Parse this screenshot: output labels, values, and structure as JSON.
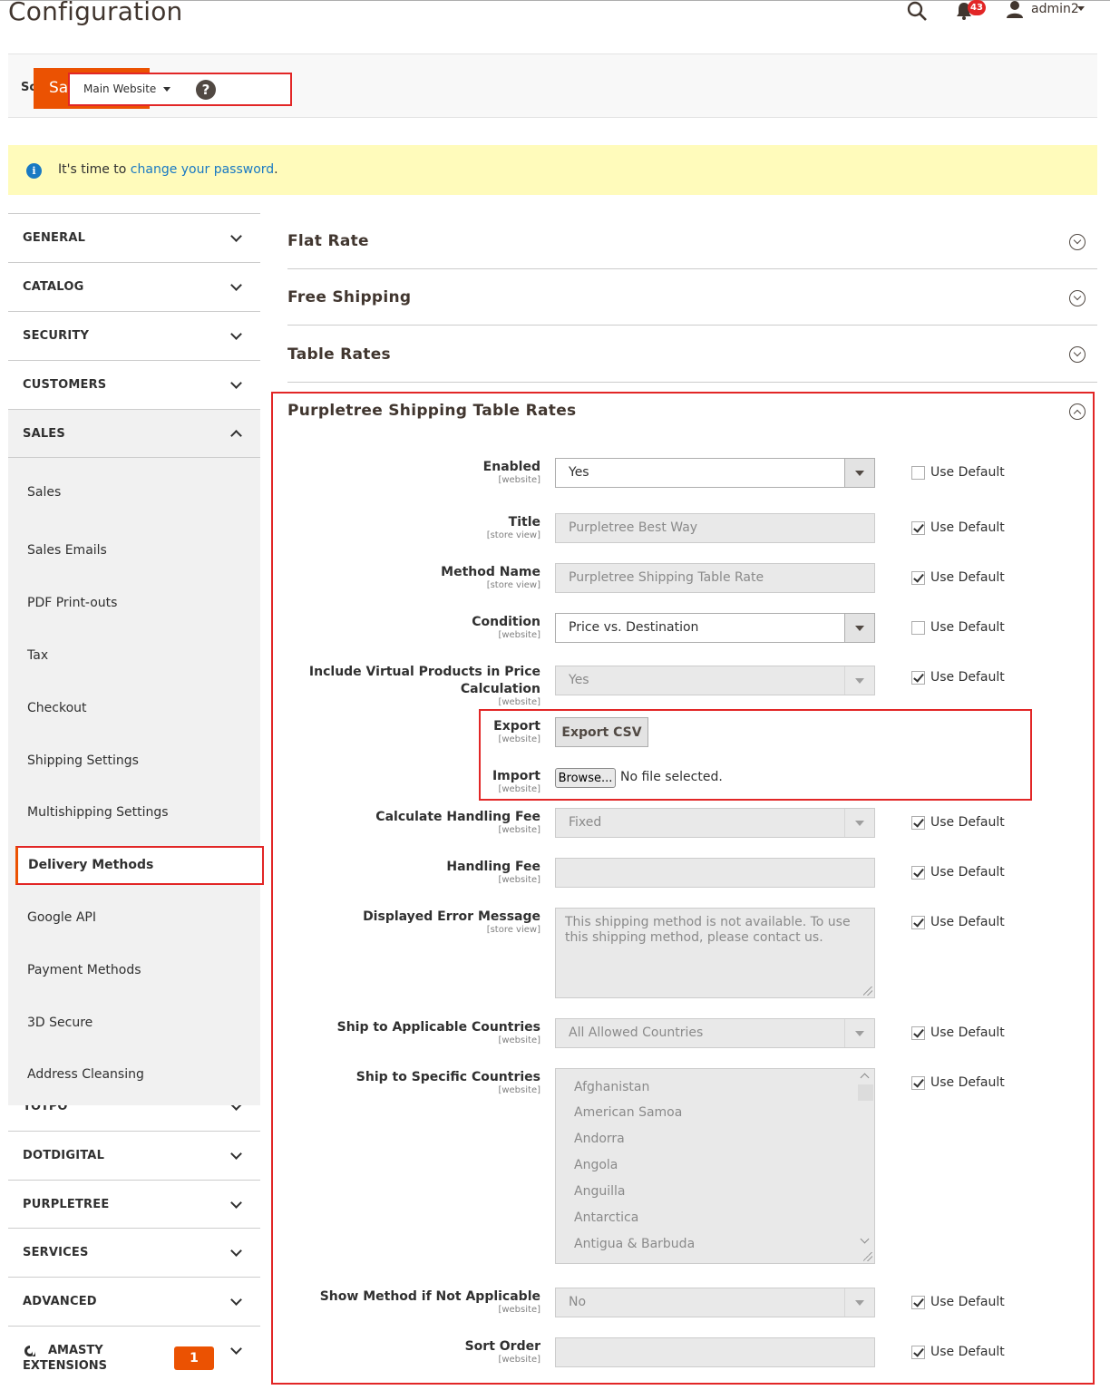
{
  "header": {
    "page_title": "Configuration",
    "notification_count": "43",
    "user_name": "admin2"
  },
  "pagebar": {
    "scope_label": "Sc",
    "save_label": "Save Config",
    "scope_value": "Main Website",
    "help_glyph": "?"
  },
  "notice": {
    "prefix": "It's time to ",
    "link": "change your password",
    "suffix": "."
  },
  "sidebar": {
    "tabs_top": [
      "GENERAL",
      "CATALOG",
      "SECURITY",
      "CUSTOMERS",
      "SALES"
    ],
    "sales_items": [
      "Sales",
      "Sales Emails",
      "PDF Print-outs",
      "Tax",
      "Checkout",
      "Shipping Settings",
      "Multishipping Settings",
      "Delivery Methods",
      "Google API",
      "Payment Methods",
      "3D Secure",
      "Address Cleansing"
    ],
    "active_item": "Delivery Methods",
    "partial_tab": "YOTPO",
    "tabs_bottom": [
      "DOTDIGITAL",
      "PURPLETREE",
      "SERVICES",
      "ADVANCED"
    ],
    "amasty_label_1": "AMASTY",
    "amasty_label_2": "EXTENSIONS",
    "amasty_badge": "1"
  },
  "sections": {
    "collapsed": [
      "Flat Rate",
      "Free Shipping",
      "Table Rates"
    ],
    "open_title": "Purpletree Shipping Table Rates"
  },
  "form": {
    "use_default": "Use Default",
    "enabled": {
      "label": "Enabled",
      "scope": "[website]",
      "value": "Yes",
      "use_default": false
    },
    "title": {
      "label": "Title",
      "scope": "[store view]",
      "value": "Purpletree Best Way",
      "use_default": true
    },
    "method_name": {
      "label": "Method Name",
      "scope": "[store view]",
      "value": "Purpletree Shipping Table Rate",
      "use_default": true
    },
    "condition": {
      "label": "Condition",
      "scope": "[website]",
      "value": "Price vs. Destination",
      "use_default": false
    },
    "include_virtual": {
      "label_1": "Include Virtual Products in Price",
      "label_2": "Calculation",
      "scope": "[website]",
      "value": "Yes",
      "use_default": true
    },
    "export": {
      "label": "Export",
      "scope": "[website]",
      "button": "Export CSV"
    },
    "import": {
      "label": "Import",
      "scope": "[website]",
      "browse": "Browse...",
      "file_status": "No file selected."
    },
    "handling_type": {
      "label": "Calculate Handling Fee",
      "scope": "[website]",
      "value": "Fixed",
      "use_default": true
    },
    "handling_fee": {
      "label": "Handling Fee",
      "scope": "[website]",
      "value": "",
      "use_default": true
    },
    "error_message": {
      "label": "Displayed Error Message",
      "scope": "[store view]",
      "value": "This shipping method is not available. To use this shipping method, please contact us.",
      "use_default": true
    },
    "applicable_countries": {
      "label": "Ship to Applicable Countries",
      "scope": "[website]",
      "value": "All Allowed Countries",
      "use_default": true
    },
    "specific_countries": {
      "label": "Ship to Specific Countries",
      "scope": "[website]",
      "options": [
        "Afghanistan",
        "American Samoa",
        "Andorra",
        "Angola",
        "Anguilla",
        "Antarctica",
        "Antigua & Barbuda"
      ],
      "use_default": true
    },
    "show_method": {
      "label": "Show Method if Not Applicable",
      "scope": "[website]",
      "value": "No",
      "use_default": true
    },
    "sort_order": {
      "label": "Sort Order",
      "scope": "[website]",
      "value": "",
      "use_default": true
    }
  }
}
